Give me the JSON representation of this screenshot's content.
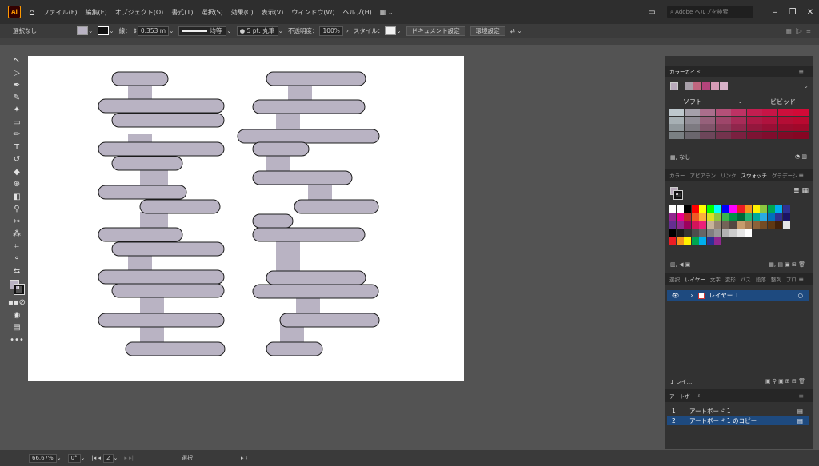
{
  "menubar": {
    "logo": "Ai",
    "items": [
      "ファイル(F)",
      "編集(E)",
      "オブジェクト(O)",
      "書式(T)",
      "選択(S)",
      "効果(C)",
      "表示(V)",
      "ウィンドウ(W)",
      "ヘルプ(H)"
    ],
    "search_placeholder": "Adobe ヘルプを検索"
  },
  "controlbar": {
    "selection": "選択なし",
    "stroke_label": "線：",
    "stroke_value": "0.353 m",
    "stroke_profile": "均等",
    "brush": "5 pt. 丸筆",
    "opacity_label": "不透明度：",
    "opacity_value": "100%",
    "style_label": "スタイル：",
    "doc_setup": "ドキュメント設定",
    "prefs": "環境設定"
  },
  "statusbar": {
    "zoom": "66.67%",
    "rotation": "0°",
    "artboard_num": "2",
    "tool": "選択"
  },
  "color_guide": {
    "tab": "カラーガイド",
    "soft": "ソフト",
    "vivid": "ビビッド",
    "none_label": "なし",
    "base_color": "#b8a9bb",
    "harmony": [
      "#a8a0aa",
      "#c0667f",
      "#b3447b",
      "#d69bb6",
      "#d7b1c8"
    ]
  },
  "swatches_panel": {
    "tabs": [
      "カラー",
      "アピアラン",
      "リンク",
      "スウォッチ",
      "グラデーシ"
    ],
    "active_tab": "スウォッチ"
  },
  "layers_panel": {
    "tabs": [
      "選択",
      "レイヤー",
      "文字",
      "変形",
      "パス",
      "段落",
      "整列",
      "プロ"
    ],
    "active_tab": "レイヤー",
    "layer_name": "レイヤー 1",
    "footer": "1 レイ..."
  },
  "artboards_panel": {
    "title": "アートボード",
    "rows": [
      {
        "num": "1",
        "name": "アートボード 1"
      },
      {
        "num": "2",
        "name": "アートボード 1 のコピー"
      }
    ]
  },
  "colors": {
    "shape_fill": "#b9b3c3",
    "shape_stroke": "#1c1c1c",
    "accent": "#1e4a7f"
  }
}
